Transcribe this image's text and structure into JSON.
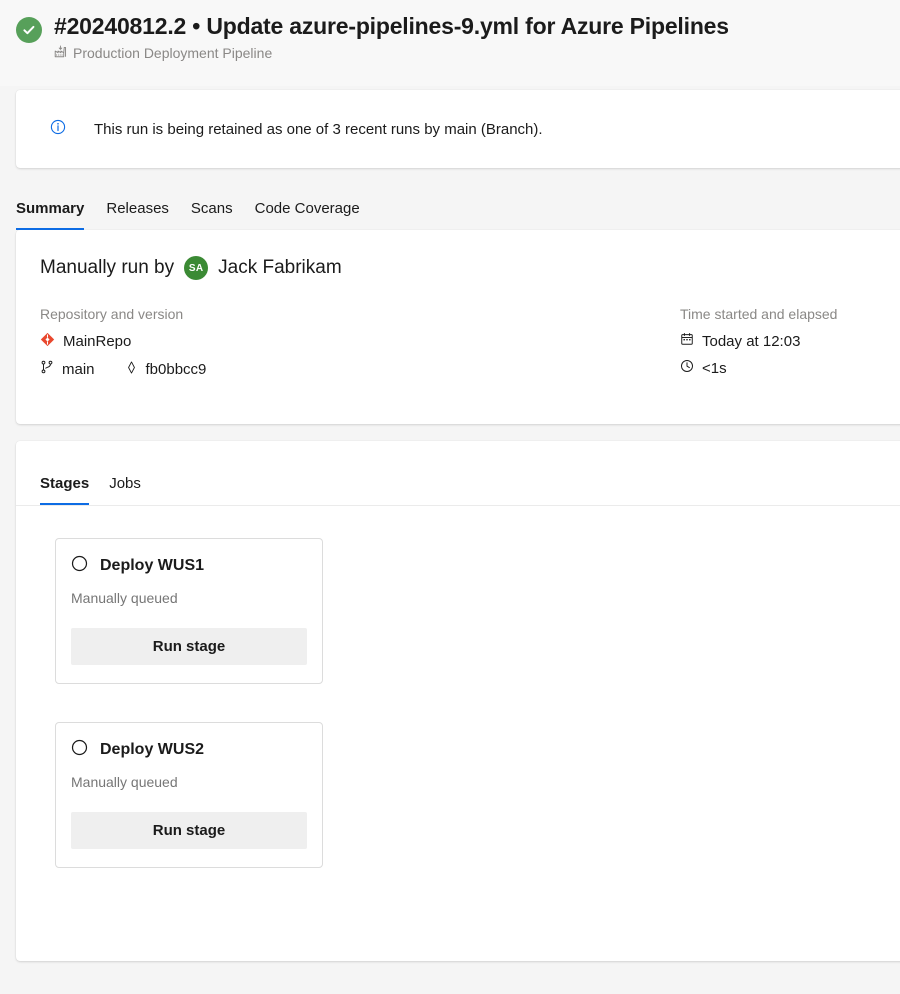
{
  "header": {
    "status_icon": "check-circle-icon",
    "status_color": "#57a05a",
    "run_title": "#20240812.2 • Update azure-pipelines-9.yml for Azure Pipelines",
    "pipeline_icon": "pipeline-factory-icon",
    "pipeline_name": "Production Deployment Pipeline"
  },
  "banner": {
    "icon": "info-circle-icon",
    "icon_color": "#0d6ce4",
    "message": "This run is being retained as one of 3 recent runs by main (Branch)."
  },
  "main_tabs": [
    {
      "label": "Summary",
      "active": true
    },
    {
      "label": "Releases",
      "active": false
    },
    {
      "label": "Scans",
      "active": false
    },
    {
      "label": "Code Coverage",
      "active": false
    }
  ],
  "summary": {
    "run_by_prefix": "Manually run by",
    "avatar_initials": "SA",
    "avatar_color": "#3b8a34",
    "user_name": "Jack Fabrikam",
    "repository_section": {
      "heading": "Repository and version",
      "repo_icon": "git-repository-icon",
      "repo_name": "MainRepo",
      "branch_icon": "branch-icon",
      "branch_name": "main",
      "commit_icon": "commit-icon",
      "commit_hash": "fb0bbcc9"
    },
    "time_section": {
      "heading": "Time started and elapsed",
      "calendar_icon": "calendar-icon",
      "started": "Today at 12:03",
      "clock_icon": "clock-icon",
      "elapsed": "<1s"
    }
  },
  "stages_panel": {
    "tabs": [
      {
        "label": "Stages",
        "active": true
      },
      {
        "label": "Jobs",
        "active": false
      }
    ],
    "stages": [
      {
        "status_icon": "pending-circle-icon",
        "name": "Deploy WUS1",
        "status_text": "Manually queued",
        "action_label": "Run stage"
      },
      {
        "status_icon": "pending-circle-icon",
        "name": "Deploy WUS2",
        "status_text": "Manually queued",
        "action_label": "Run stage"
      }
    ]
  },
  "colors": {
    "accent": "#0d6ce4",
    "success": "#57a05a",
    "page_background": "#f5f5f5",
    "card_background": "#ffffff",
    "muted_text": "#8a8886"
  }
}
